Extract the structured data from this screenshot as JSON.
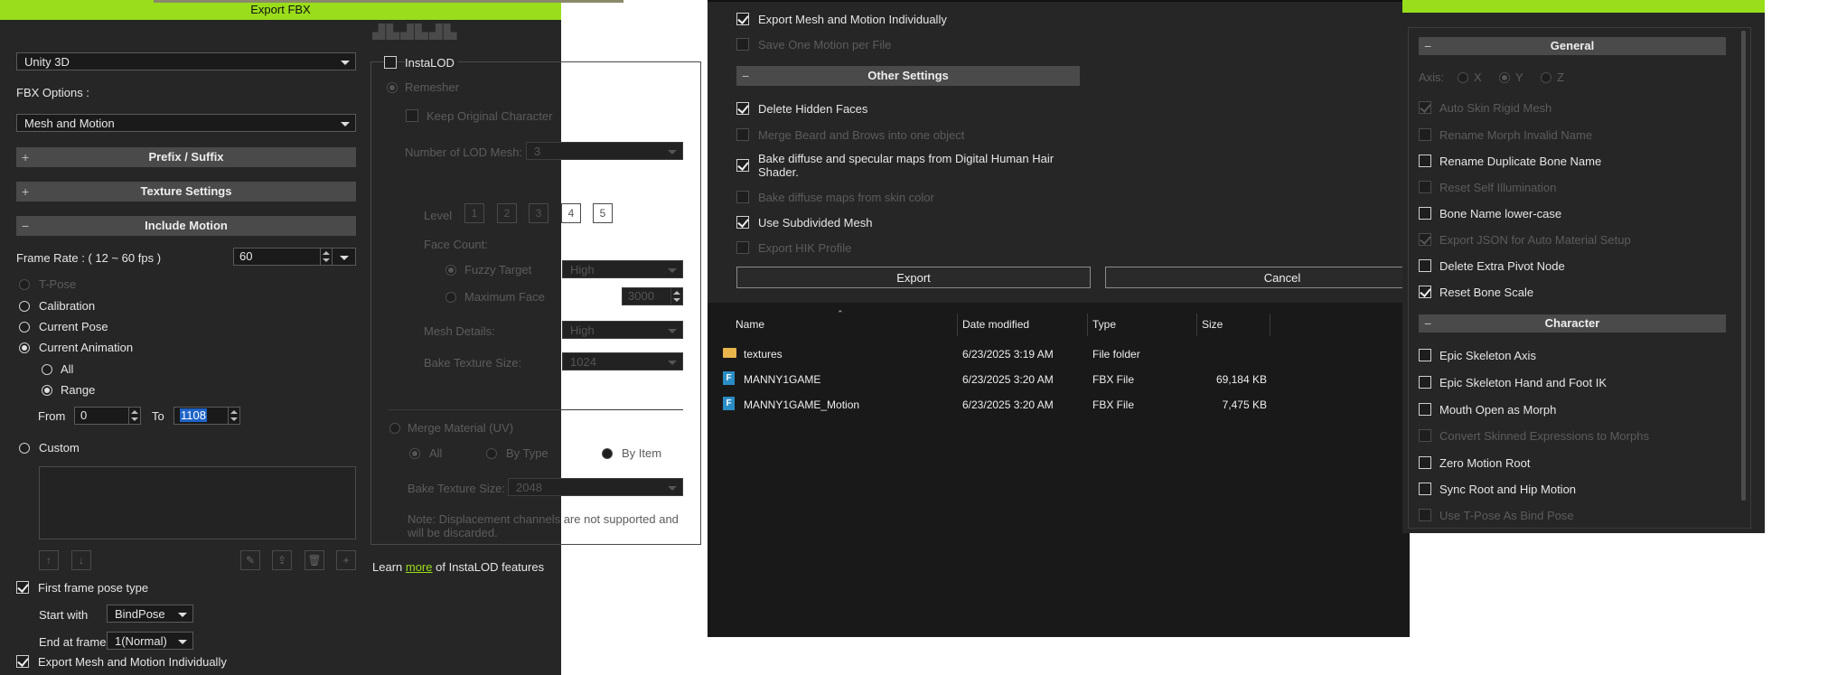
{
  "colors": {
    "accent": "#9ade1b",
    "panel": "#262626",
    "section": "#4a4a4a",
    "selection": "#1e64c8"
  },
  "left": {
    "title": "Export FBX",
    "target": "Unity 3D",
    "fbx_options_label": "FBX Options :",
    "fbx_option": "Mesh and Motion",
    "prefix_suffix": "Prefix / Suffix",
    "texture_settings": "Texture Settings",
    "include_motion": "Include Motion",
    "frame_rate_label": "Frame Rate : ( 12 ~ 60 fps )",
    "frame_rate_value": "60",
    "tpose": "T-Pose",
    "calibration": "Calibration",
    "current_pose": "Current Pose",
    "current_animation": "Current Animation",
    "all": "All",
    "range": "Range",
    "from_label": "From",
    "from_value": "0",
    "to_label": "To",
    "to_value": "1108",
    "custom": "Custom",
    "first_frame": "First frame pose type",
    "start_with_label": "Start with",
    "start_with_value": "BindPose",
    "end_frame_label": "End at frame",
    "end_frame_value": "1(Normal)",
    "export_individually": "Export Mesh and Motion Individually",
    "instalod": "InstaLOD",
    "remesher": "Remesher",
    "keep_original": "Keep Original Character",
    "lod_count_label": "Number of LOD Mesh:",
    "lod_count_value": "3",
    "level_label": "Level",
    "levels": [
      "1",
      "2",
      "3",
      "4",
      "5"
    ],
    "face_count_label": "Face Count:",
    "fuzzy_target": "Fuzzy Target",
    "fuzzy_value": "High",
    "maximum_face": "Maximum Face",
    "maximum_face_value": "3000",
    "mesh_details_label": "Mesh Details:",
    "mesh_details_value": "High",
    "bake_texture_label": "Bake Texture Size:",
    "bake_texture_value": "1024",
    "merge_material": "Merge Material (UV)",
    "merge_all": "All",
    "merge_by_type": "By Type",
    "merge_by_item": "By Item",
    "bake_texture2_value": "2048",
    "note": "Note: Displacement channels are not supported and will be discarded.",
    "learn_prefix": "Learn",
    "learn_link": "more",
    "learn_suffix": "of InstaLOD features"
  },
  "middle": {
    "export_individually": "Export Mesh and Motion Individually",
    "save_one_motion": "Save One Motion per File",
    "other_settings": "Other Settings",
    "delete_hidden": "Delete Hidden Faces",
    "merge_beard": "Merge Beard and Brows into one object",
    "bake_diffuse": "Bake diffuse and specular maps from Digital Human Hair Shader.",
    "bake_skin": "Bake diffuse maps from skin color",
    "use_subdivided": "Use Subdivided Mesh",
    "export_hik": "Export HIK Profile",
    "export_button": "Export",
    "cancel_button": "Cancel"
  },
  "explorer": {
    "columns": {
      "name": "Name",
      "date": "Date modified",
      "type": "Type",
      "size": "Size"
    },
    "rows": [
      {
        "name": "textures",
        "date": "6/23/2025 3:19 AM",
        "type": "File folder",
        "size": "",
        "icon": "folder-icon"
      },
      {
        "name": "MANNY1GAME",
        "date": "6/23/2025 3:20 AM",
        "type": "FBX File",
        "size": "69,184 KB",
        "icon": "fbx-file-icon"
      },
      {
        "name": "MANNY1GAME_Motion",
        "date": "6/23/2025 3:20 AM",
        "type": "FBX File",
        "size": "7,475 KB",
        "icon": "fbx-file-icon"
      }
    ]
  },
  "right": {
    "general": "General",
    "axis_label": "Axis:",
    "axis_x": "X",
    "axis_y": "Y",
    "axis_z": "Z",
    "auto_skin": "Auto Skin Rigid Mesh",
    "rename_morph": "Rename Morph Invalid Name",
    "rename_duplicate": "Rename Duplicate Bone Name",
    "reset_self_illum": "Reset Self Illumination",
    "bone_lower": "Bone Name lower-case",
    "export_json": "Export JSON for Auto Material Setup",
    "delete_pivot": "Delete Extra Pivot Node",
    "reset_bone_scale": "Reset Bone Scale",
    "character": "Character",
    "epic_axis": "Epic Skeleton Axis",
    "epic_hand": "Epic Skeleton Hand and Foot IK",
    "mouth_open": "Mouth Open as Morph",
    "convert_skinned": "Convert Skinned Expressions to Morphs",
    "zero_motion": "Zero Motion Root",
    "sync_root": "Sync Root and Hip Motion",
    "use_tpose": "Use T-Pose As Bind Pose"
  }
}
